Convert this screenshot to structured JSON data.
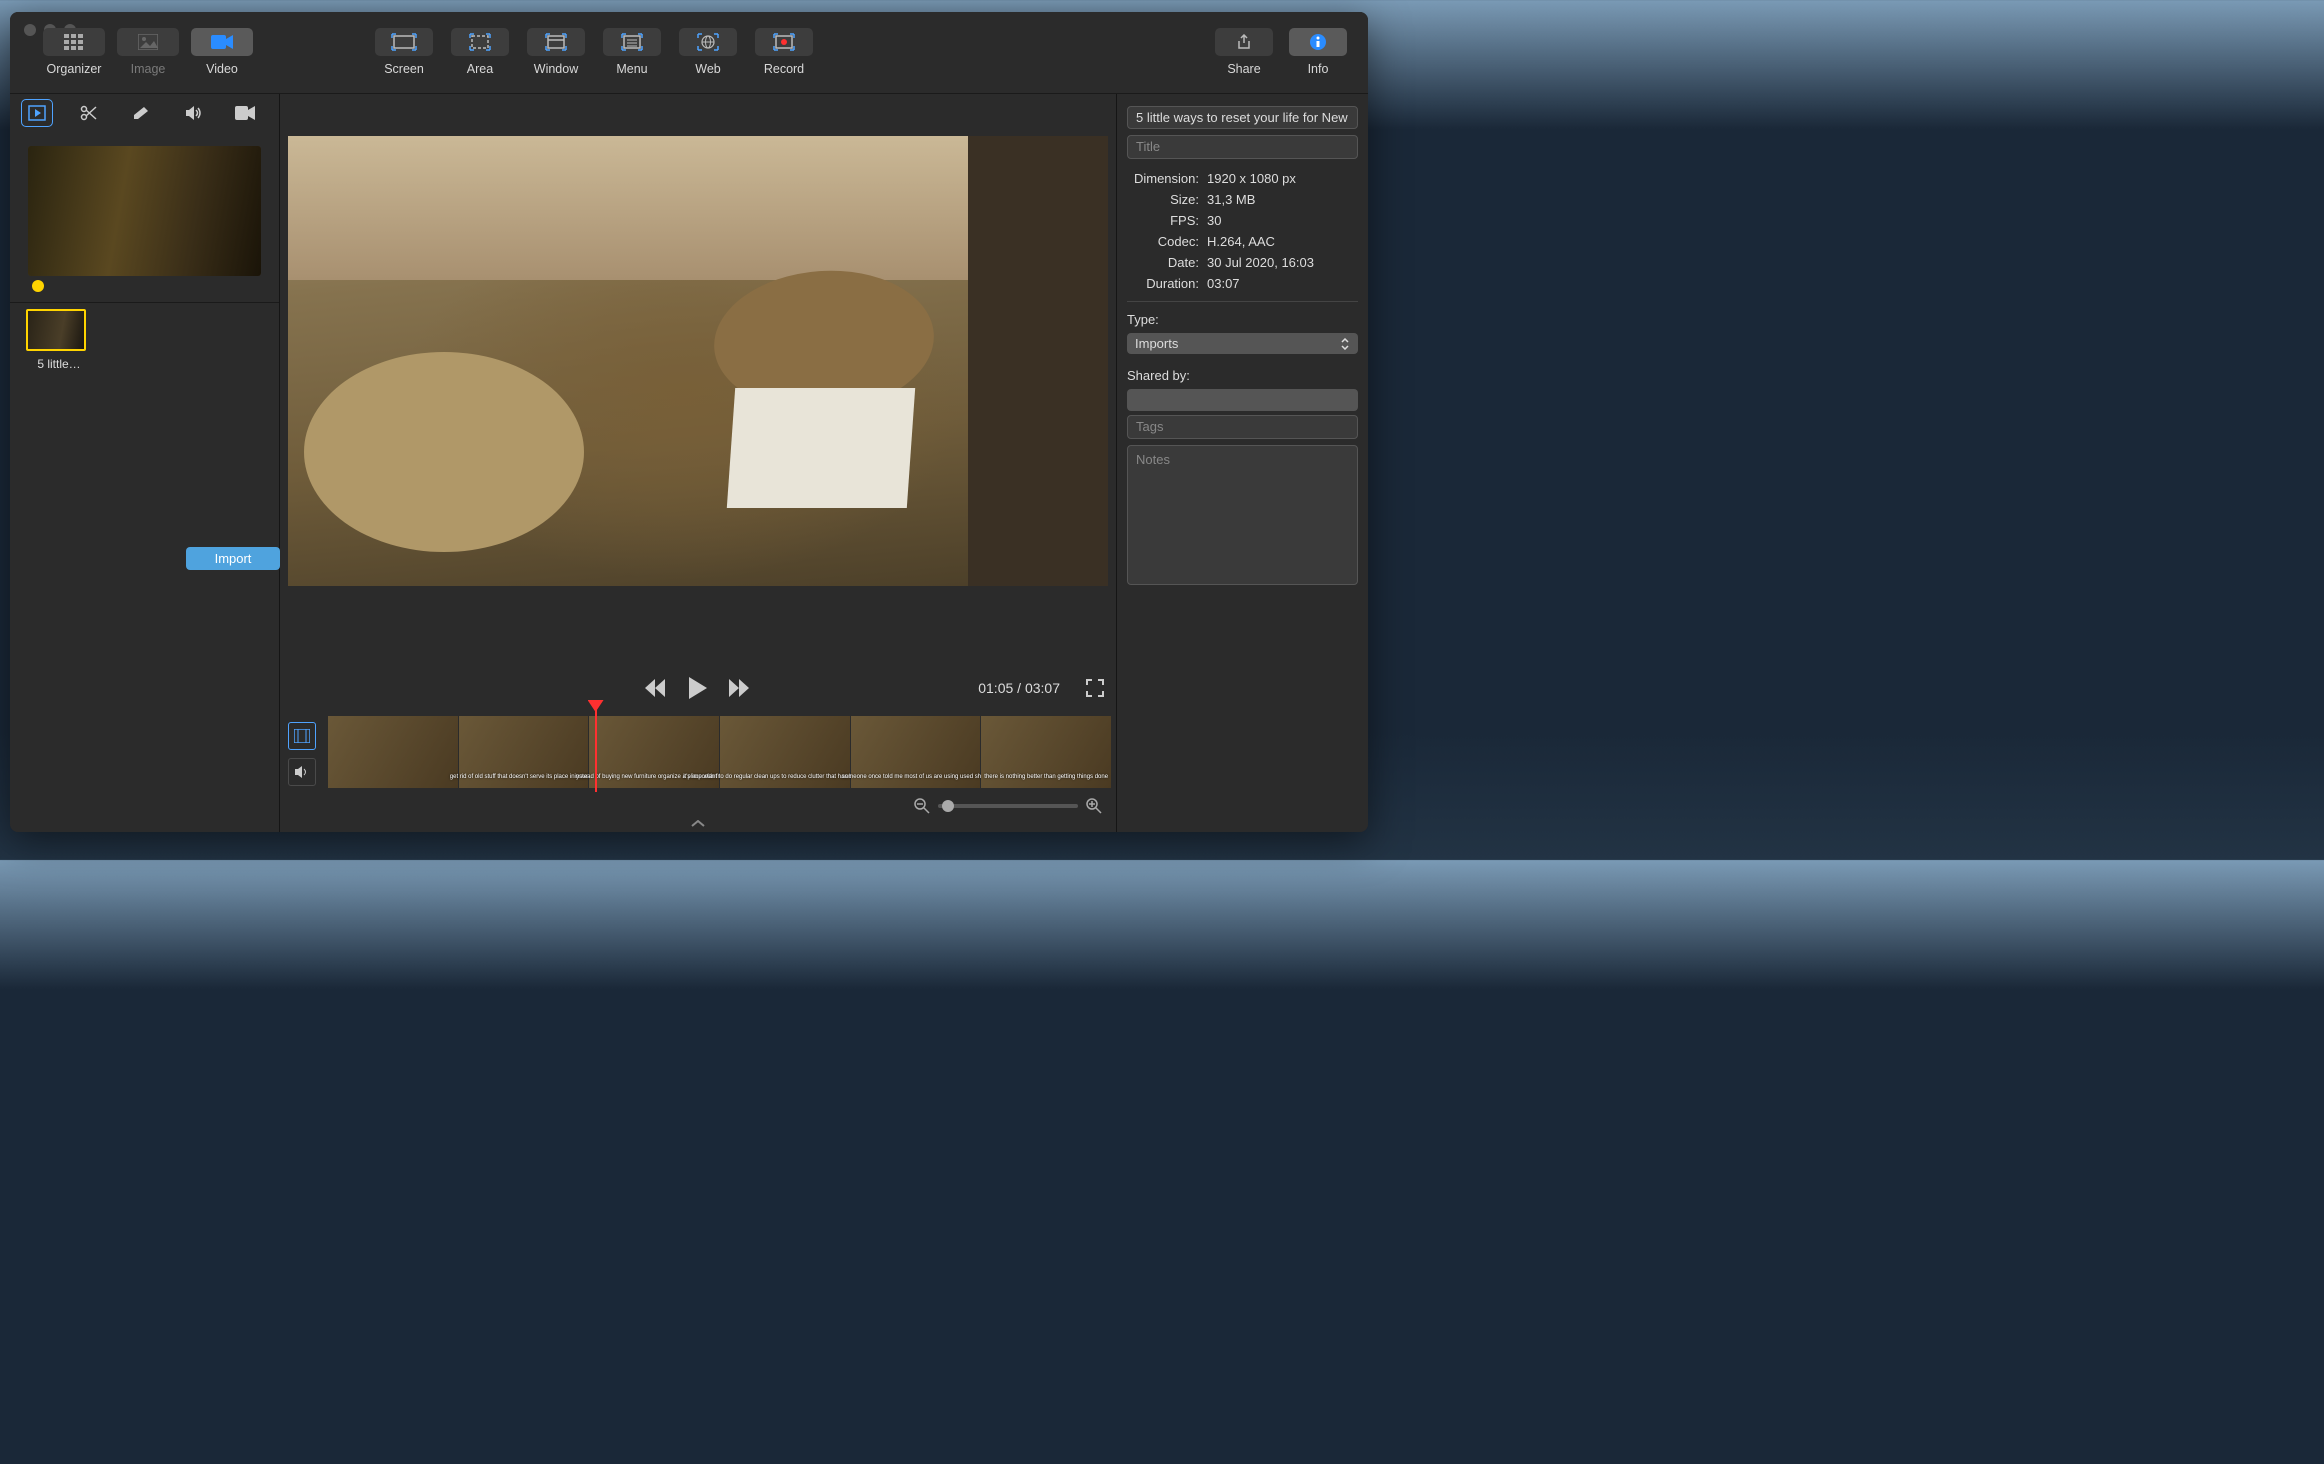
{
  "toolbar": {
    "organizer_label": "Organizer",
    "image_label": "Image",
    "video_label": "Video",
    "capture": {
      "screen": "Screen",
      "area": "Area",
      "window": "Window",
      "menu": "Menu",
      "web": "Web",
      "record": "Record"
    },
    "share_label": "Share",
    "info_label": "Info"
  },
  "left": {
    "thumb_label": "5 little…",
    "import_label": "Import"
  },
  "player": {
    "current_time": "01:05",
    "total_time": "03:07"
  },
  "info": {
    "filename": "5 little ways to reset your life for New",
    "title_placeholder": "Title",
    "dimension_label": "Dimension:",
    "dimension_value": "1920 x 1080 px",
    "size_label": "Size:",
    "size_value": "31,3 MB",
    "fps_label": "FPS:",
    "fps_value": "30",
    "codec_label": "Codec:",
    "codec_value": "H.264, AAC",
    "date_label": "Date:",
    "date_value": "30 Jul 2020, 16:03",
    "duration_label": "Duration:",
    "duration_value": "03:07",
    "type_label": "Type:",
    "type_value": "Imports",
    "shared_by_label": "Shared by:",
    "tags_placeholder": "Tags",
    "notes_placeholder": "Notes"
  }
}
